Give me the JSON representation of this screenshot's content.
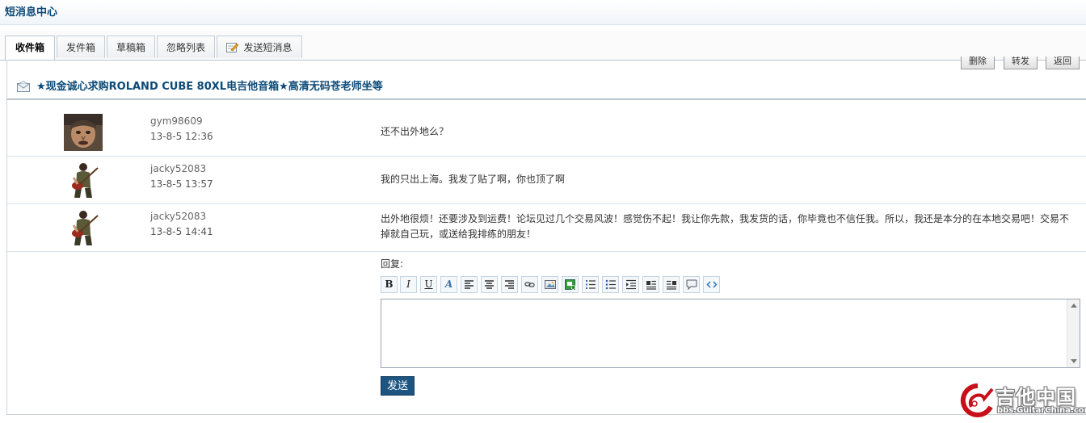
{
  "header": {
    "title": "短消息中心"
  },
  "tabs": [
    {
      "label": "收件箱",
      "active": true
    },
    {
      "label": "发件箱"
    },
    {
      "label": "草稿箱"
    },
    {
      "label": "忽略列表"
    },
    {
      "label": "发送短消息"
    }
  ],
  "actions": {
    "delete": "删除",
    "forward": "转发",
    "back": "返回"
  },
  "subject": "★现金诚心求购ROLAND CUBE 80XL电吉他音箱★高清无码苍老师坐等",
  "messages": [
    {
      "user": "gym98609",
      "time": "13-8-5 12:36",
      "text": "还不出外地么？"
    },
    {
      "user": "jacky52083",
      "time": "13-8-5 13:57",
      "text": "我的只出上海。我发了贴了啊，你也顶了啊"
    },
    {
      "user": "jacky52083",
      "time": "13-8-5 14:41",
      "text": "出外地很烦！还要涉及到运费！论坛见过几个交易风波！感觉伤不起！我让你先款，我发货的话，你毕竟也不信任我。所以，我还是本分的在本地交易吧！交易不掉就自己玩，或送给我排练的朋友！"
    }
  ],
  "reply": {
    "label": "回复:",
    "toolbar": [
      "bold-icon",
      "italic-icon",
      "underline-icon",
      "font-color-icon",
      "align-left-icon",
      "align-center-icon",
      "align-right-icon",
      "link-icon",
      "image-icon",
      "insert-media-icon",
      "ordered-list-icon",
      "unordered-list-icon",
      "indent-icon",
      "float-left-icon",
      "float-right-icon",
      "quote-icon",
      "code-icon"
    ],
    "bold": "B",
    "italic": "I",
    "underline": "U",
    "font_color": "A",
    "send_label": "发送"
  },
  "watermark": {
    "text": "吉他中国",
    "sub": "bbs.GuitarChina.com"
  },
  "colors": {
    "accent": "#0c4a77",
    "send_button": "#1d5580",
    "divider": "#d7e5ea"
  }
}
